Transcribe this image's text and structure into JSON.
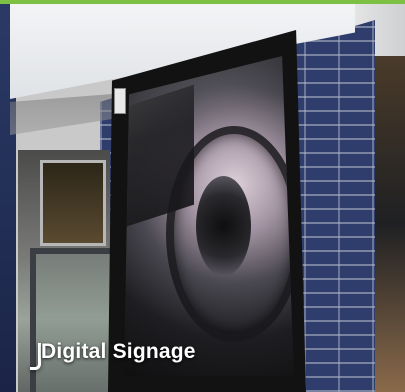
{
  "caption": {
    "text": "Digital Signage"
  },
  "icons": {
    "caption_icon": "bracket-icon"
  },
  "colors": {
    "accent_bar": "#7cc144",
    "brick": "#2f3d6c",
    "display_bezel": "#121212"
  }
}
